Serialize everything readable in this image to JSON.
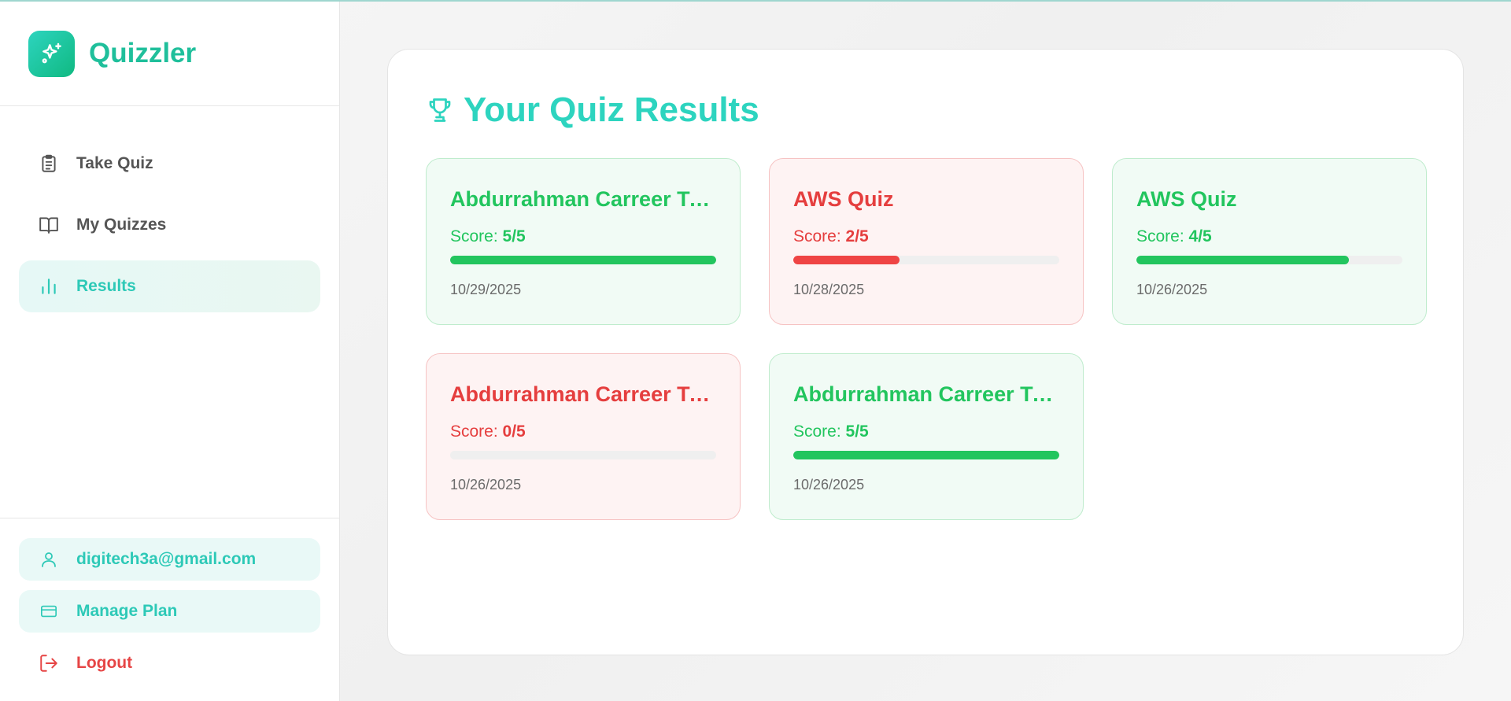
{
  "app": {
    "name": "Quizzler"
  },
  "nav": {
    "items": [
      {
        "label": "Take Quiz",
        "icon": "clipboard-icon",
        "active": false
      },
      {
        "label": "My Quizzes",
        "icon": "book-open-icon",
        "active": false
      },
      {
        "label": "Results",
        "icon": "bar-chart-icon",
        "active": true
      }
    ]
  },
  "account": {
    "email": "digitech3a@gmail.com",
    "manage_plan": "Manage Plan",
    "logout": "Logout"
  },
  "main": {
    "title": "Your Quiz Results",
    "results": [
      {
        "title": "Abdurrahman Carreer Tri...",
        "score_label": "Score:",
        "score": "5/5",
        "fraction": 1.0,
        "date": "10/29/2025",
        "status": "pass"
      },
      {
        "title": "AWS Quiz",
        "score_label": "Score:",
        "score": "2/5",
        "fraction": 0.4,
        "date": "10/28/2025",
        "status": "fail"
      },
      {
        "title": "AWS Quiz",
        "score_label": "Score:",
        "score": "4/5",
        "fraction": 0.8,
        "date": "10/26/2025",
        "status": "pass"
      },
      {
        "title": "Abdurrahman Carreer Tri...",
        "score_label": "Score:",
        "score": "0/5",
        "fraction": 0.0,
        "date": "10/26/2025",
        "status": "fail"
      },
      {
        "title": "Abdurrahman Carreer Tri...",
        "score_label": "Score:",
        "score": "5/5",
        "fraction": 1.0,
        "date": "10/26/2025",
        "status": "pass"
      }
    ]
  },
  "colors": {
    "accent": "#2dd4bf",
    "pass": "#22c55e",
    "fail": "#ef4444"
  }
}
